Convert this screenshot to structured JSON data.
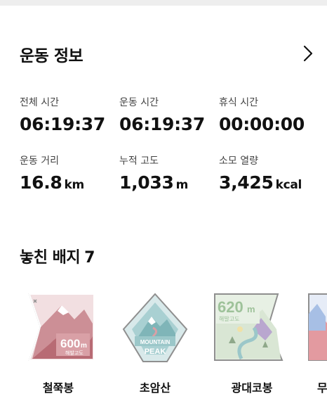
{
  "section": {
    "title": "운동 정보"
  },
  "stats": [
    {
      "label": "전체 시간",
      "value": "06:19:37",
      "unit": ""
    },
    {
      "label": "운동 시간",
      "value": "06:19:37",
      "unit": ""
    },
    {
      "label": "휴식 시간",
      "value": "00:00:00",
      "unit": ""
    },
    {
      "label": "운동 거리",
      "value": "16.8",
      "unit": "km"
    },
    {
      "label": "누적 고도",
      "value": "1,033",
      "unit": "m"
    },
    {
      "label": "소모 열량",
      "value": "3,425",
      "unit": "kcal"
    }
  ],
  "badges_section": {
    "title_prefix": "놓친 배지",
    "count": "7"
  },
  "badges": [
    {
      "name": "철쭉봉",
      "altitude": "600",
      "unit": "m",
      "sublabel": "해발고도",
      "icon": "mountain-600m-badge-icon"
    },
    {
      "name": "초암산",
      "line1": "MOUNTAIN",
      "line2": "PEAK",
      "icon": "mountain-peak-badge-icon"
    },
    {
      "name": "광대코봉",
      "altitude": "620",
      "unit": "m",
      "sublabel": "해발고도",
      "icon": "mountain-620m-badge-icon"
    },
    {
      "name": "무"
    }
  ],
  "colors": {
    "badge_border": "#a0a0a0",
    "badge_red": "#d9a0a6",
    "badge_teal": "#9bc7c9",
    "badge_purple": "#b9a7cf"
  }
}
